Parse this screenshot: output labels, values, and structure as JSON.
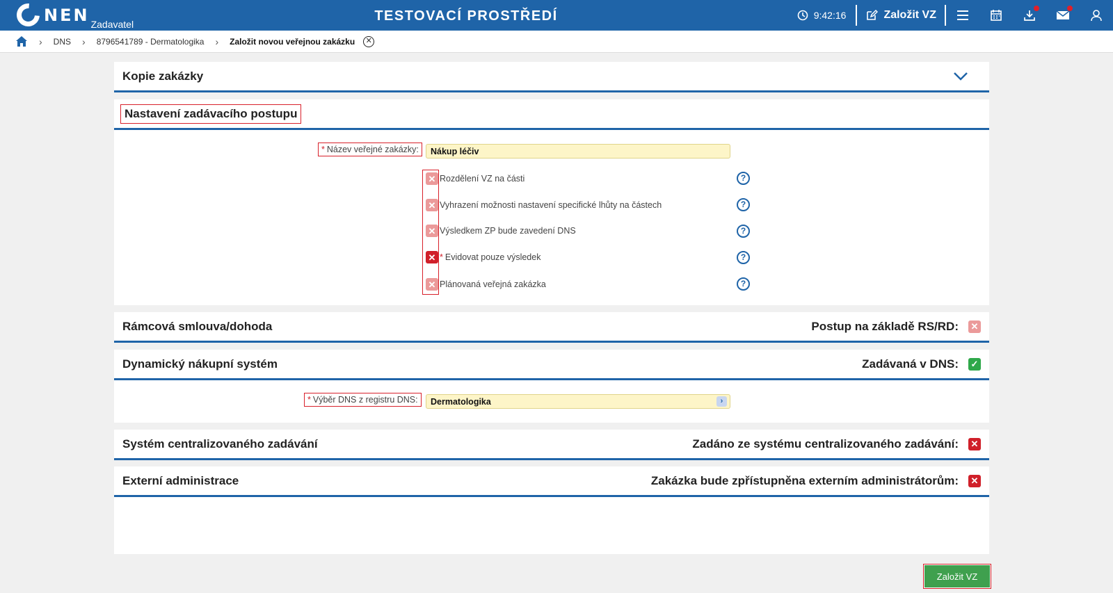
{
  "header": {
    "logo_text": "NEN",
    "logo_sub": "Zadavatel",
    "env_title": "TESTOVACÍ PROSTŘEDÍ",
    "time": "9:42:16",
    "create_label": "Založit VZ",
    "icons": [
      "clock-icon",
      "edit-icon",
      "menu-icon",
      "calendar-icon",
      "download-icon",
      "mail-icon",
      "user-icon"
    ]
  },
  "breadcrumb": {
    "items": [
      "DNS",
      "8796541789 - Dermatologika"
    ],
    "current": "Založit novou veřejnou zakázku"
  },
  "sections": {
    "copy": {
      "title": "Kopie zakázky"
    },
    "setup": {
      "title": "Nastavení zadávacího postupu",
      "name_label": "Název veřejné zakázky:",
      "name_value": "Nákup léčiv",
      "options": [
        {
          "label": "Rozdělení VZ na části",
          "state": "off",
          "required": false
        },
        {
          "label": "Vyhrazení možnosti nastavení specifické lhůty na částech",
          "state": "off",
          "required": false
        },
        {
          "label": "Výsledkem ZP bude zavedení DNS",
          "state": "off",
          "required": false
        },
        {
          "label": "Evidovat pouze výsledek",
          "state": "red",
          "required": true
        },
        {
          "label": "Plánovaná veřejná zakázka",
          "state": "off",
          "required": false
        }
      ]
    },
    "framework": {
      "title": "Rámcová smlouva/dohoda",
      "right_label": "Postup na základě RS/RD:",
      "state": "off"
    },
    "dns": {
      "title": "Dynamický nákupní systém",
      "right_label": "Zadávaná v DNS:",
      "state": "checked",
      "select_label": "Výběr DNS z registru DNS:",
      "select_value": "Dermatologika"
    },
    "central": {
      "title": "Systém centralizovaného zadávání",
      "right_label": "Zadáno ze systému centralizovaného zadávání:",
      "state": "red"
    },
    "external": {
      "title": "Externí administrace",
      "right_label": "Zakázka bude zpřístupněna externím administrátorům:",
      "state": "red"
    }
  },
  "submit_label": "Založit VZ",
  "colors": {
    "primary": "#1f64a8",
    "required": "#d0202a",
    "success": "#3fa04e",
    "field_bg": "#fdf5c8"
  }
}
